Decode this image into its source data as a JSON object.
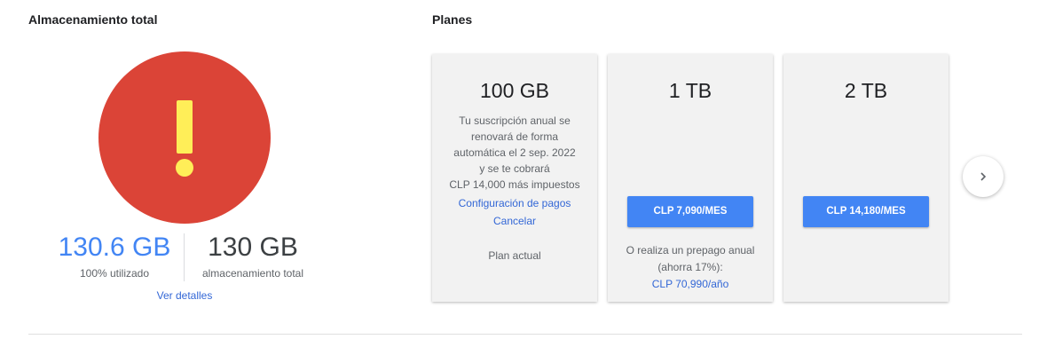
{
  "storage": {
    "title": "Almacenamiento total",
    "alert_color": "#db4437",
    "alert_mark_color": "#ffee58",
    "used_value": "130.6 GB",
    "used_caption": "100% utilizado",
    "total_value": "130 GB",
    "total_caption": "almacenamiento total",
    "details_link": "Ver detalles"
  },
  "plans": {
    "title": "Planes",
    "cards": [
      {
        "size": "100 GB",
        "description_lines": [
          "Tu suscripción anual se",
          "renovará de forma",
          "automática el 2 sep. 2022",
          "y se te cobrará",
          "CLP 14,000 más impuestos"
        ],
        "config_link": "Configuración de pagos",
        "cancel_link": "Cancelar",
        "current_label": "Plan actual"
      },
      {
        "size": "1 TB",
        "price_button": "CLP 7,090/MES",
        "prepay_line1": "O realiza un prepago anual",
        "prepay_line2": "(ahorra 17%):",
        "prepay_price": "CLP 70,990/año"
      },
      {
        "size": "2 TB",
        "price_button": "CLP 14,180/MES"
      }
    ],
    "next_icon": "chevron-right-icon"
  },
  "colors": {
    "accent_blue": "#4285f4",
    "link_blue": "#3367d6",
    "card_bg": "#f2f2f2"
  }
}
